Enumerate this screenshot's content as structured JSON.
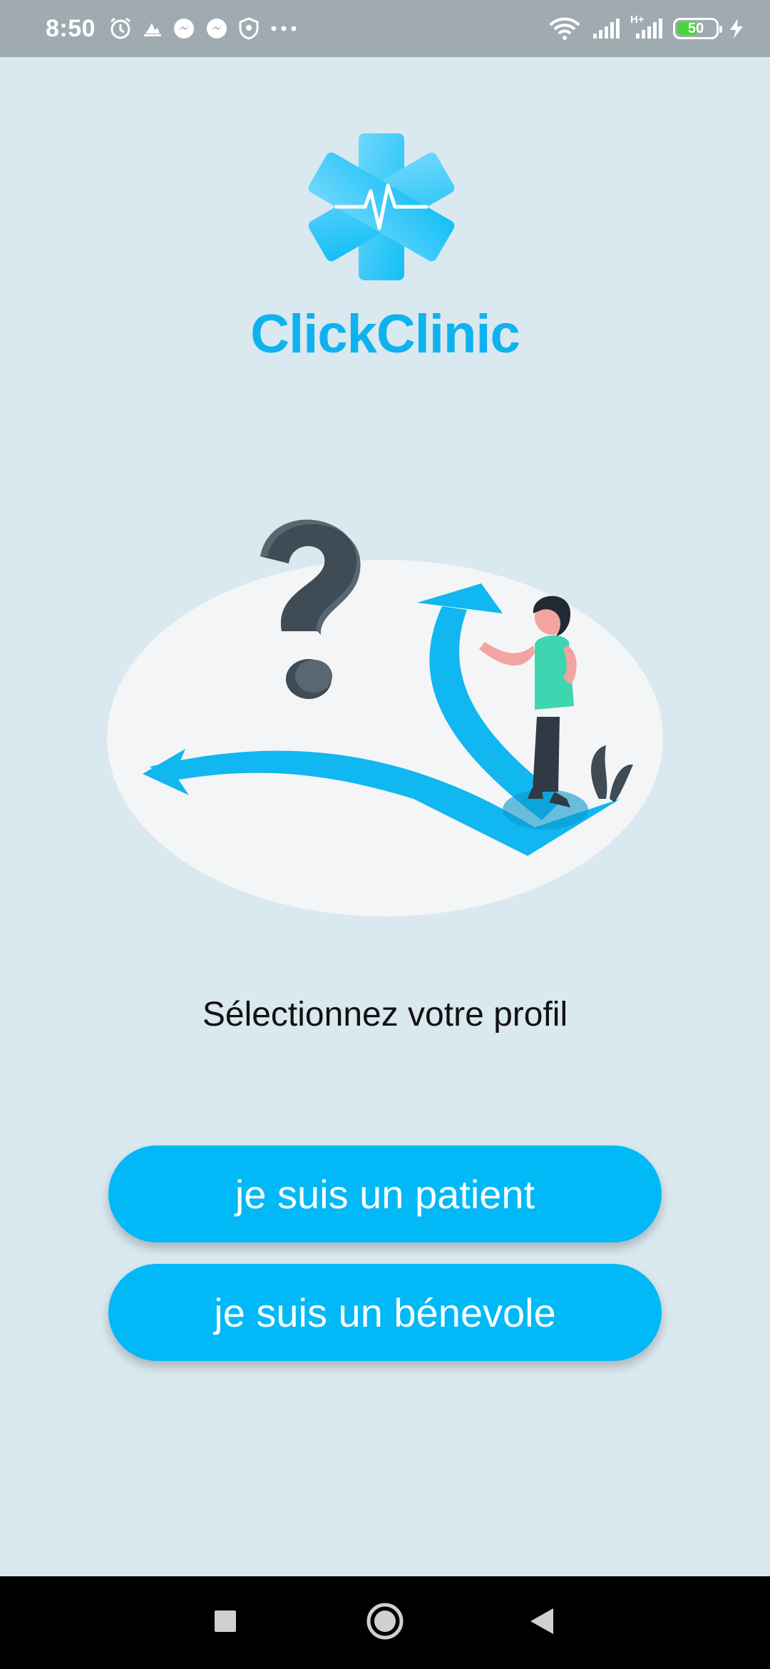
{
  "status_bar": {
    "time": "8:50",
    "battery_level": "50",
    "left_icons": [
      "alarm-icon",
      "cloud-icon",
      "messenger-icon",
      "messenger-icon",
      "shield-icon",
      "more-icon"
    ],
    "right_icons": [
      "wifi-icon",
      "signal-icon",
      "signal-hplus-icon",
      "battery-icon",
      "charging-icon"
    ],
    "network_label": "H+"
  },
  "app": {
    "name": "ClickClinic",
    "logo_icon": "medical-star-icon",
    "brand_color": "#0fb2ee"
  },
  "illustration": {
    "icon": "decision-crossroads-illustration"
  },
  "main": {
    "prompt": "Sélectionnez votre profil",
    "patient_button": "je suis un patient",
    "volunteer_button": "je suis un bénevole",
    "button_color": "#00b9f6"
  },
  "navigation": {
    "items": [
      "recents-button",
      "home-button",
      "back-button"
    ]
  }
}
